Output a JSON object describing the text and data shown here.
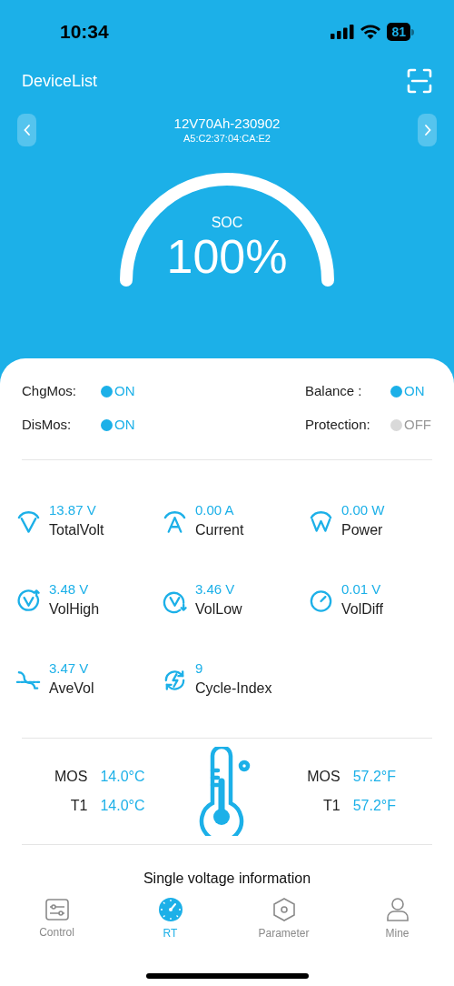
{
  "status_bar": {
    "time": "10:34",
    "battery": "81"
  },
  "header": {
    "title": "DeviceList"
  },
  "device": {
    "name": "12V70Ah-230902",
    "mac": "A5:C2:37:04:CA:E2"
  },
  "soc": {
    "label": "SOC",
    "value": "100%"
  },
  "switches": [
    {
      "label": "ChgMos:",
      "state": "ON",
      "on": true
    },
    {
      "label": "Balance :",
      "state": "ON",
      "on": true
    },
    {
      "label": "DisMos:",
      "state": "ON",
      "on": true
    },
    {
      "label": "Protection:",
      "state": "OFF",
      "on": false
    }
  ],
  "metrics": [
    {
      "kind": "volt",
      "value": "13.87 V",
      "label": "TotalVolt"
    },
    {
      "kind": "amp",
      "value": "0.00 A",
      "label": "Current"
    },
    {
      "kind": "watt",
      "value": "0.00 W",
      "label": "Power"
    },
    {
      "kind": "high",
      "value": "3.48 V",
      "label": "VolHigh"
    },
    {
      "kind": "low",
      "value": "3.46 V",
      "label": "VolLow"
    },
    {
      "kind": "diff",
      "value": "0.01 V",
      "label": "VolDiff"
    },
    {
      "kind": "avg",
      "value": "3.47 V",
      "label": "AveVol"
    },
    {
      "kind": "cycle",
      "value": "9",
      "label": "Cycle-Index"
    }
  ],
  "temperatures_c": [
    {
      "label": "MOS",
      "value": "14.0°C"
    },
    {
      "label": "T1",
      "value": "14.0°C"
    }
  ],
  "temperatures_f": [
    {
      "label": "MOS",
      "value": "57.2°F"
    },
    {
      "label": "T1",
      "value": "57.2°F"
    }
  ],
  "section_title": "Single voltage information",
  "tab_bar": [
    {
      "kind": "control",
      "label": "Control",
      "selected": false
    },
    {
      "kind": "rt",
      "label": "RT",
      "selected": true
    },
    {
      "kind": "parameter",
      "label": "Parameter",
      "selected": false
    },
    {
      "kind": "mine",
      "label": "Mine",
      "selected": false
    }
  ]
}
